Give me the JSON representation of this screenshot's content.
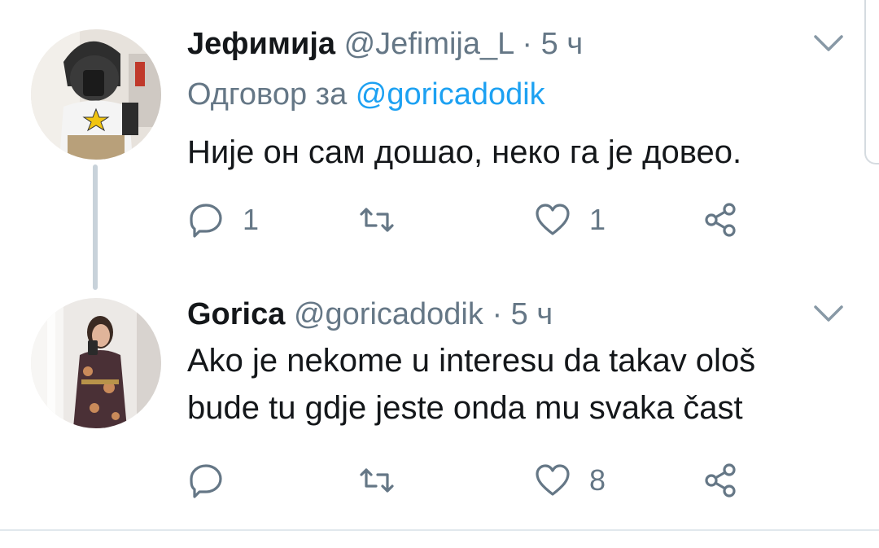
{
  "tweets": [
    {
      "name": "Јефимија",
      "handle": "@Jefimija_L",
      "separator": "·",
      "time": "5 ч",
      "reply_prefix": "Одговор за",
      "reply_to": "@goricadodik",
      "text": "Није он сам дошао, неко га је довео.",
      "replies": "1",
      "retweets": "",
      "likes": "1"
    },
    {
      "name": "Gorica",
      "handle": "@goricadodik",
      "separator": "·",
      "time": "5 ч",
      "text_line1": "Ako je nekome u interesu da takav ološ",
      "text_line2": "bude tu gdje jeste onda mu svaka čast",
      "replies": "",
      "retweets": "",
      "likes": "8"
    }
  ],
  "icons": {
    "reply": "reply-icon",
    "retweet": "retweet-icon",
    "like": "heart-icon",
    "share": "share-icon",
    "menu": "chevron-down-icon"
  },
  "colors": {
    "text": "#14171a",
    "secondary": "#657786",
    "link": "#1da1f2",
    "thread_line": "#c8d2da",
    "divider": "#e1e8ed"
  }
}
